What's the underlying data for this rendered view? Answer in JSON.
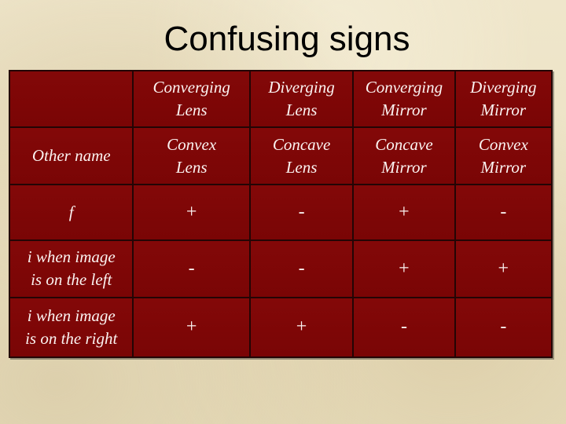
{
  "slide": {
    "title": "Confusing signs"
  },
  "table": {
    "header": {
      "corner": "",
      "columns": [
        {
          "line1": "Converging",
          "line2": "Lens"
        },
        {
          "line1": "Diverging",
          "line2": "Lens"
        },
        {
          "line1": "Converging",
          "line2": "Mirror"
        },
        {
          "line1": "Diverging",
          "line2": "Mirror"
        }
      ]
    },
    "rows": [
      {
        "label": {
          "line1": "Other name",
          "line2": ""
        },
        "cells": [
          {
            "line1": "Convex",
            "line2": "Lens"
          },
          {
            "line1": "Concave",
            "line2": "Lens"
          },
          {
            "line1": "Concave",
            "line2": "Mirror"
          },
          {
            "line1": "Convex",
            "line2": "Mirror"
          }
        ]
      },
      {
        "label": {
          "line1": "f",
          "line2": ""
        },
        "cells": [
          "+",
          "-",
          "+",
          "-"
        ]
      },
      {
        "label": {
          "line1": "i when image",
          "line2": "is on the left"
        },
        "cells": [
          "-",
          "-",
          "+",
          "+"
        ]
      },
      {
        "label": {
          "line1": "i when image",
          "line2": "is on the right"
        },
        "cells": [
          "+",
          "+",
          "-",
          "-"
        ]
      }
    ]
  },
  "colors": {
    "background": "#ece2c4",
    "cell_fill": "#7e0606",
    "cell_border": "#230505",
    "cell_text": "#fbf3f1",
    "title_text": "#000000"
  }
}
